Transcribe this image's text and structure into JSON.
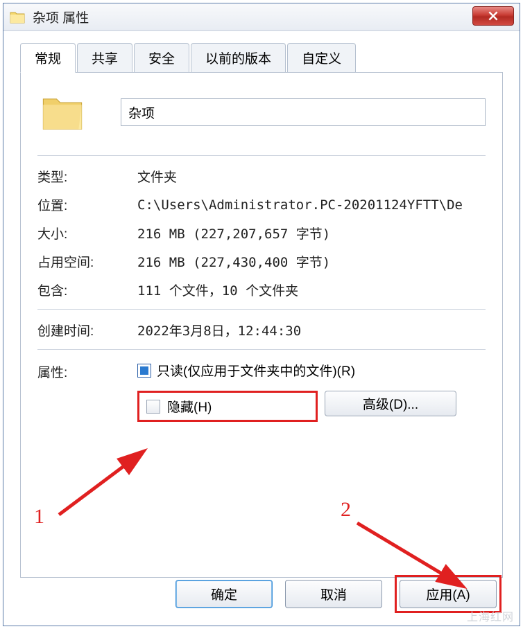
{
  "window": {
    "title": "杂项 属性"
  },
  "tabs": {
    "general": "常规",
    "share": "共享",
    "security": "安全",
    "previous": "以前的版本",
    "custom": "自定义"
  },
  "folder_name": "杂项",
  "labels": {
    "type": "类型:",
    "location": "位置:",
    "size": "大小:",
    "size_on_disk": "占用空间:",
    "contains": "包含:",
    "created": "创建时间:",
    "attributes": "属性:"
  },
  "values": {
    "type": "文件夹",
    "location": "C:\\Users\\Administrator.PC-20201124YFTT\\De",
    "size": "216 MB (227,207,657 字节)",
    "size_on_disk": "216 MB (227,430,400 字节)",
    "contains": "111 个文件，10 个文件夹",
    "created": "2022年3月8日，12:44:30"
  },
  "checkboxes": {
    "readonly": "只读(仅应用于文件夹中的文件)(R)",
    "hidden": "隐藏(H)"
  },
  "buttons": {
    "advanced": "高级(D)...",
    "ok": "确定",
    "cancel": "取消",
    "apply": "应用(A)"
  },
  "annotations": {
    "one": "1",
    "two": "2"
  },
  "watermark": "上海红网"
}
